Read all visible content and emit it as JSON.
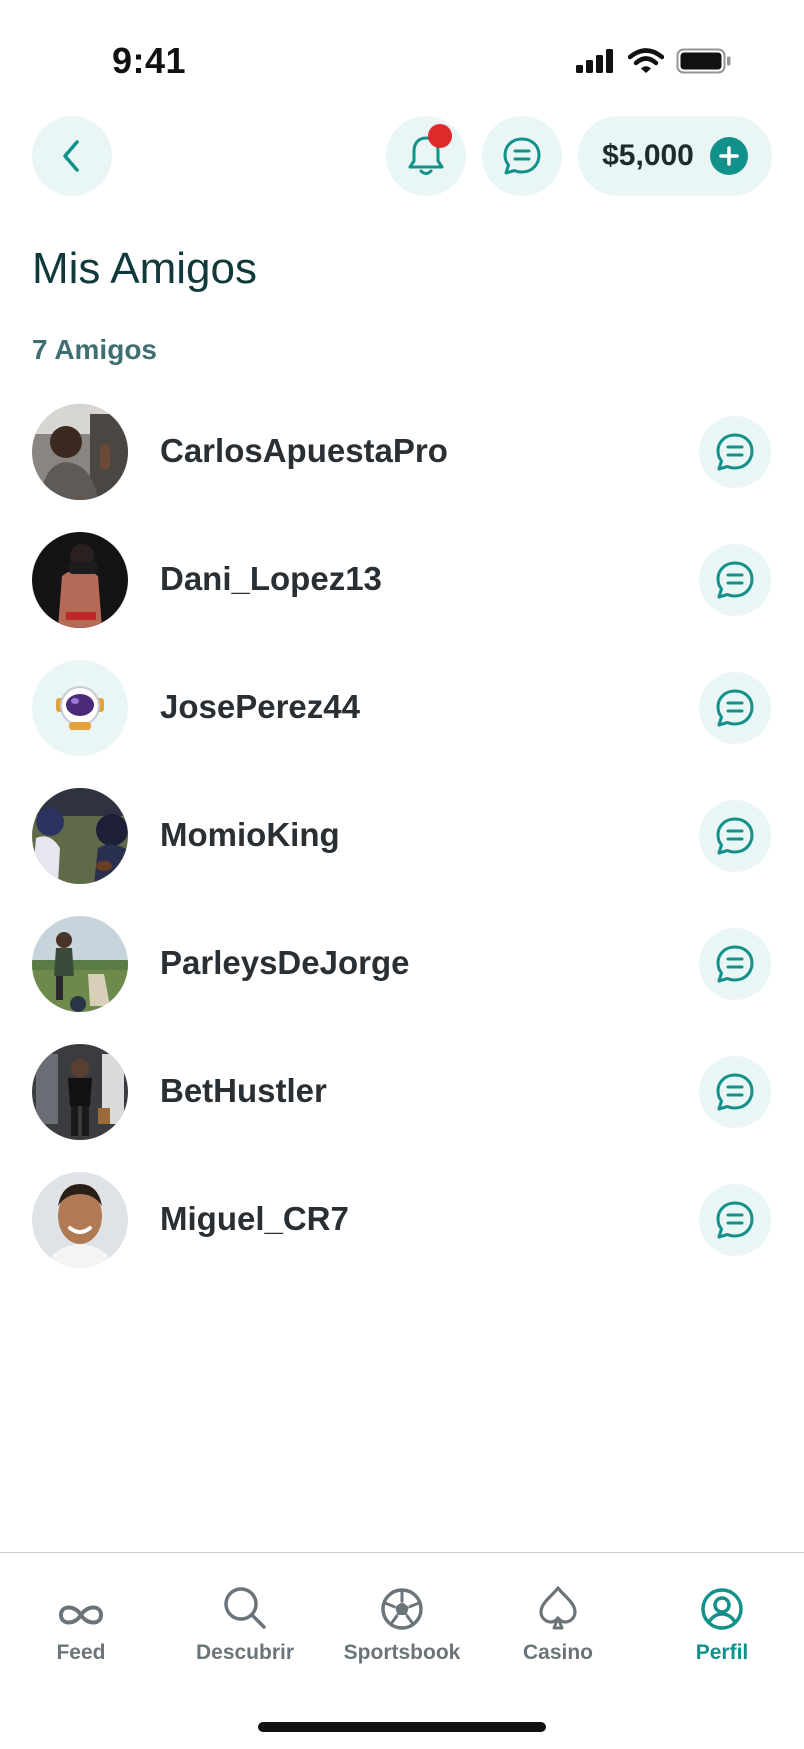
{
  "status_bar": {
    "time": "9:41"
  },
  "header": {
    "back_icon": "chevron-left-icon",
    "notification_icon": "bell-icon",
    "messages_icon": "chat-bubble-icon",
    "balance": "$5,000",
    "add_funds_icon": "plus-icon"
  },
  "page": {
    "title": "Mis Amigos",
    "friends_count": "7 Amigos"
  },
  "friends": [
    {
      "username": "CarlosApuestaPro"
    },
    {
      "username": "Dani_Lopez13"
    },
    {
      "username": "JosePerez44"
    },
    {
      "username": "MomioKing"
    },
    {
      "username": "ParleysDeJorge"
    },
    {
      "username": "BetHustler"
    },
    {
      "username": "Miguel_CR7"
    }
  ],
  "tab_bar": {
    "tabs": [
      {
        "label": "Feed",
        "icon": "infinity-icon",
        "active": false
      },
      {
        "label": "Descubrir",
        "icon": "search-icon",
        "active": false
      },
      {
        "label": "Sportsbook",
        "icon": "soccer-ball-icon",
        "active": false
      },
      {
        "label": "Casino",
        "icon": "spade-icon",
        "active": false
      },
      {
        "label": "Perfil",
        "icon": "user-circle-icon",
        "active": true
      }
    ]
  },
  "colors": {
    "accent": "#12918b",
    "button_bg": "#e9f6f5",
    "title": "#10393c",
    "notification": "#e02a2a"
  }
}
